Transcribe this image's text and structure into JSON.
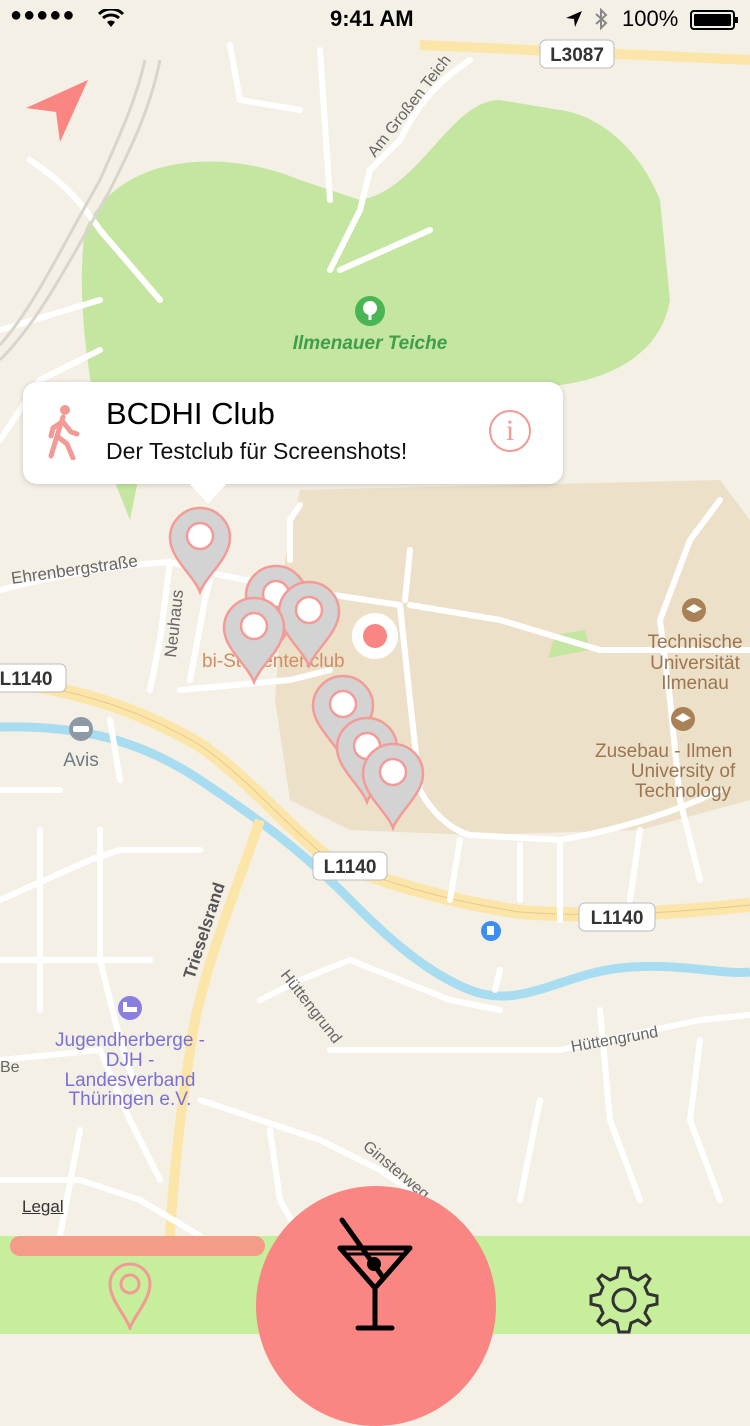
{
  "status_bar": {
    "carrier": "●●●●●",
    "time": "9:41 AM",
    "battery": "100%"
  },
  "map": {
    "roads": {
      "l3087": "L3087",
      "l1140_a": "L1140",
      "l1140_b": "L1140",
      "l1140_c": "L1140"
    },
    "streets": {
      "am_grossen_teich": "Am Großen Teich",
      "ehrenbergstrasse": "Ehrenbergstraße",
      "neuhaus": "Neuhaus",
      "trieselsrand": "Trieselsrand",
      "huettengrund_a": "Hüttengrund",
      "huettengrund_b": "Hüttengrund",
      "ginsterweg": "Ginsterweg",
      "be": "Be"
    },
    "places": {
      "park": "Ilmenauer Teiche",
      "club": "bi-Studentenclub",
      "avis": "Avis",
      "tu_line1": "Technische",
      "tu_line2": "Universität",
      "tu_line3": "Ilmenau",
      "zusebau_line1": "Zusebau - Ilmen",
      "zusebau_line2": "University of",
      "zusebau_line3": "Technology",
      "hostel_line1": "Jugendherberge -",
      "hostel_line2": "DJH -",
      "hostel_line3": "Landesverband",
      "hostel_line4": "Thüringen e.V."
    },
    "legal": "Legal"
  },
  "callout": {
    "title": "BCDHI Club",
    "subtitle": "Der Testclub für Screenshots!"
  },
  "tabbar": {
    "progress_fraction": 0.34
  },
  "colors": {
    "map_bg": "#f5f0e6",
    "park": "#c4e6a1",
    "campus": "#ede0c9",
    "river": "#a8dcf0",
    "road_major": "#fce5a8",
    "pin": "#d3d3d3",
    "pin_stroke": "#f39b97",
    "user_dot": "#f98683",
    "tabbar": "#c6ee9b",
    "cocktail_button": "#f98683",
    "accent": "#f29a95"
  },
  "icons": [
    "location-arrow-icon",
    "walking-person-icon",
    "info-icon",
    "map-pin-icon",
    "cocktail-icon",
    "gear-icon",
    "tree-icon",
    "car-icon",
    "university-icon",
    "bed-icon",
    "fuel-icon"
  ]
}
